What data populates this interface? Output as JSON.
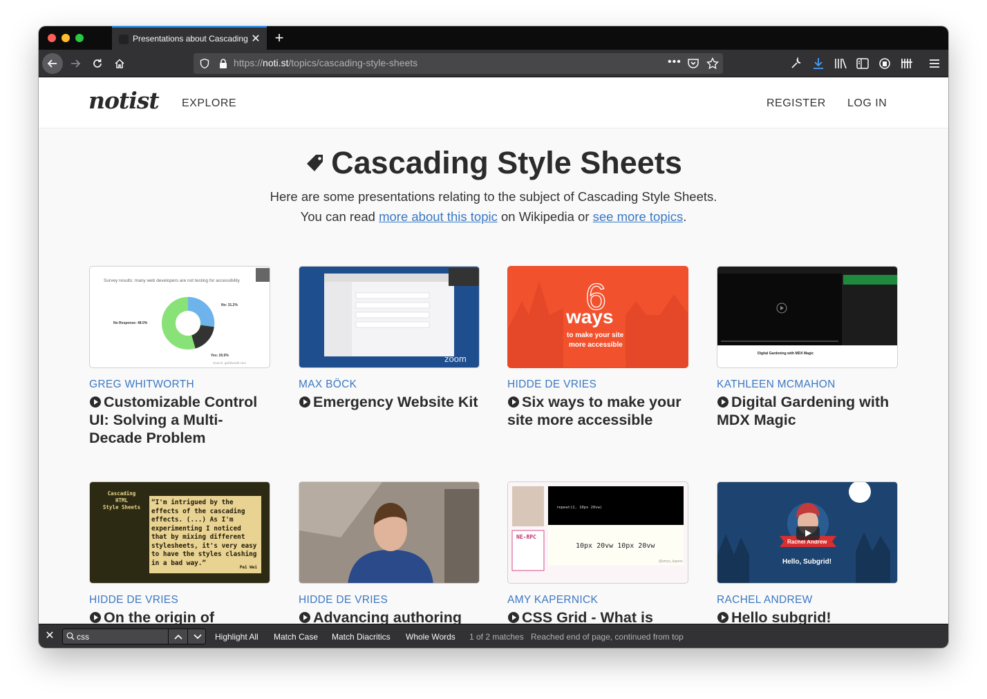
{
  "browser": {
    "tab_title": "Presentations about Cascading",
    "url_scheme": "https://",
    "url_host": "noti.st",
    "url_path": "/topics/cascading-style-sheets"
  },
  "site": {
    "logo": "notist",
    "nav_explore": "EXPLORE",
    "nav_register": "REGISTER",
    "nav_login": "LOG IN"
  },
  "topic": {
    "title": "Cascading Style Sheets",
    "intro_line1": "Here are some presentations relating to the subject of Cascading Style Sheets.",
    "intro_prefix": "You can read",
    "intro_link1": "more about this topic",
    "intro_middle": "on Wikipedia or",
    "intro_link2": "see more topics",
    "intro_suffix": "."
  },
  "cards": [
    {
      "author": "GREG WHITWORTH",
      "title": "Customizable Control UI: Solving a Multi-Decade Problem",
      "thumb": {
        "heading": "Survey results: many web developers are not testing for accessibility",
        "no": "No: 31.2%",
        "no_response": "No Response: 48.0%",
        "yes": "Yes: 20.0%",
        "source": "Source: gwhitworth.com"
      }
    },
    {
      "author": "MAX BÖCK",
      "title": "Emergency Website Kit",
      "thumb": {
        "brand": "zoom"
      }
    },
    {
      "author": "HIDDE DE VRIES",
      "title": "Six ways to make your site more accessible",
      "thumb": {
        "number": "6",
        "word": "ways",
        "line1": "to make your site",
        "line2": "more accessible"
      }
    },
    {
      "author": "KATHLEEN MCMAHON",
      "title": "Digital Gardening with MDX Magic",
      "thumb": {
        "caption": "Digital Gardening with MDX Magic"
      }
    },
    {
      "author": "HIDDE DE VRIES",
      "title": "On the origin of",
      "thumb": {
        "label1": "Cascading",
        "label2": "HTML",
        "label3": "Style Sheets",
        "quote": "“I'm intrigued by the effects of the cascading effects. (...) As I'm experimenting I noticed that by mixing different stylesheets, it's very easy to have the styles clashing in a bad way.”",
        "attribution": "Pei Wei"
      }
    },
    {
      "author": "HIDDE DE VRIES",
      "title": "Advancing authoring",
      "thumb": {}
    },
    {
      "author": "AMY KAPERNICK",
      "title": "CSS Grid - What is",
      "thumb": {
        "code1": "repeat(2, 10px 20vw)",
        "code2": "10px 20vw 10px 20vw",
        "tag": "NE-RPC",
        "handle": "@amys_kapers"
      }
    },
    {
      "author": "RACHEL ANDREW",
      "title": "Hello subgrid!",
      "thumb": {
        "banner": "Rachel Andrew",
        "subtitle": "Hello, Subgrid!"
      }
    }
  ],
  "findbar": {
    "value": "css",
    "highlight_all": "Highlight All",
    "match_case": "Match Case",
    "match_diacritics": "Match Diacritics",
    "whole_words": "Whole Words",
    "matches": "1 of 2 matches",
    "status": "Reached end of page, continued from top"
  },
  "colors": {
    "link": "#3a78c3",
    "tab_accent": "#0a84ff",
    "chrome": "#323234"
  }
}
